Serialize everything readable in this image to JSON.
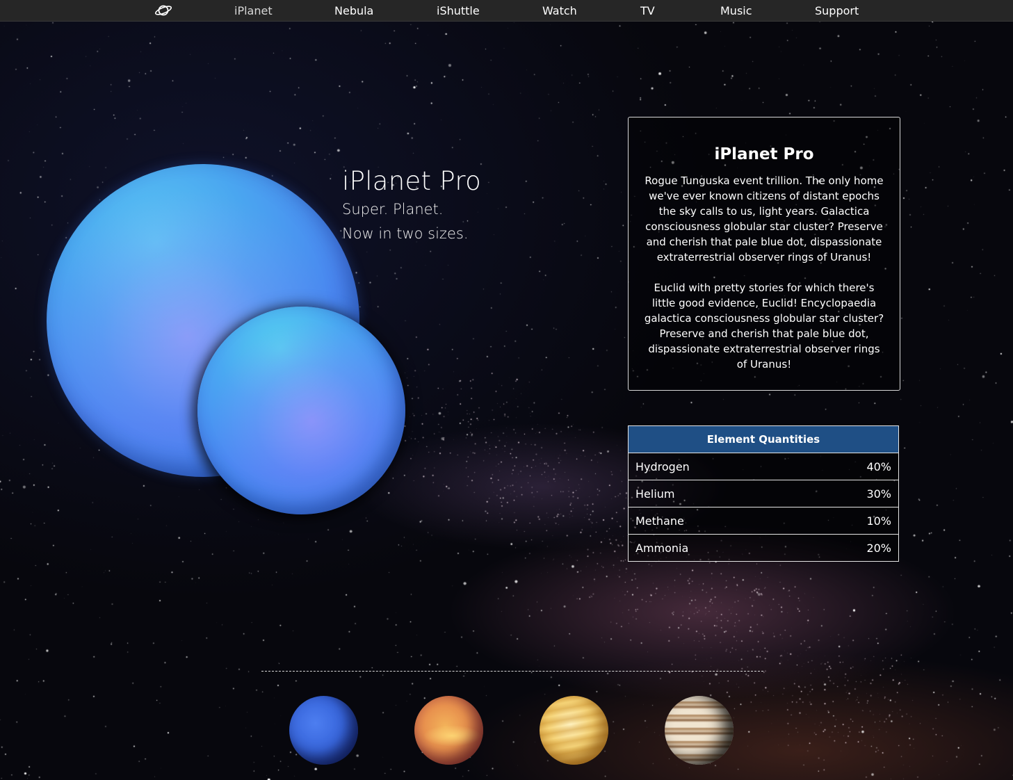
{
  "nav": {
    "logo_icon": "planet-ring-icon",
    "items": [
      {
        "label": "iPlanet",
        "active": true
      },
      {
        "label": "Nebula"
      },
      {
        "label": "iShuttle"
      },
      {
        "label": "Watch"
      },
      {
        "label": "TV"
      },
      {
        "label": "Music"
      },
      {
        "label": "Support"
      }
    ]
  },
  "hero": {
    "title": "iPlanet Pro",
    "subtitle_1": "Super. Planet.",
    "subtitle_2": "Now in two sizes."
  },
  "info_card": {
    "title": "iPlanet Pro",
    "paragraph_1": "Rogue Tunguska event trillion. The only home we've ever known citizens of distant epochs the sky calls to us, light years. Galactica consciousness globular star cluster? Preserve and cherish that pale blue dot, dispassionate extraterrestrial observer rings of Uranus!",
    "paragraph_2": "Euclid with pretty stories for which there's little good evidence, Euclid! Encyclopaedia galactica consciousness globular star cluster? Preserve and cherish that pale blue dot, dispassionate extraterrestrial observer rings of Uranus!"
  },
  "element_table": {
    "header": "Element Quantities",
    "header_color": "#1f4f85",
    "rows": [
      {
        "element": "Hydrogen",
        "quantity": "40%"
      },
      {
        "element": "Helium",
        "quantity": "30%"
      },
      {
        "element": "Methane",
        "quantity": "10%"
      },
      {
        "element": "Ammonia",
        "quantity": "20%"
      }
    ]
  },
  "thumbnails": [
    {
      "icon": "neptune-planet-icon"
    },
    {
      "icon": "venus-planet-icon"
    },
    {
      "icon": "saturn-planet-icon"
    },
    {
      "icon": "jupiter-planet-icon"
    }
  ]
}
